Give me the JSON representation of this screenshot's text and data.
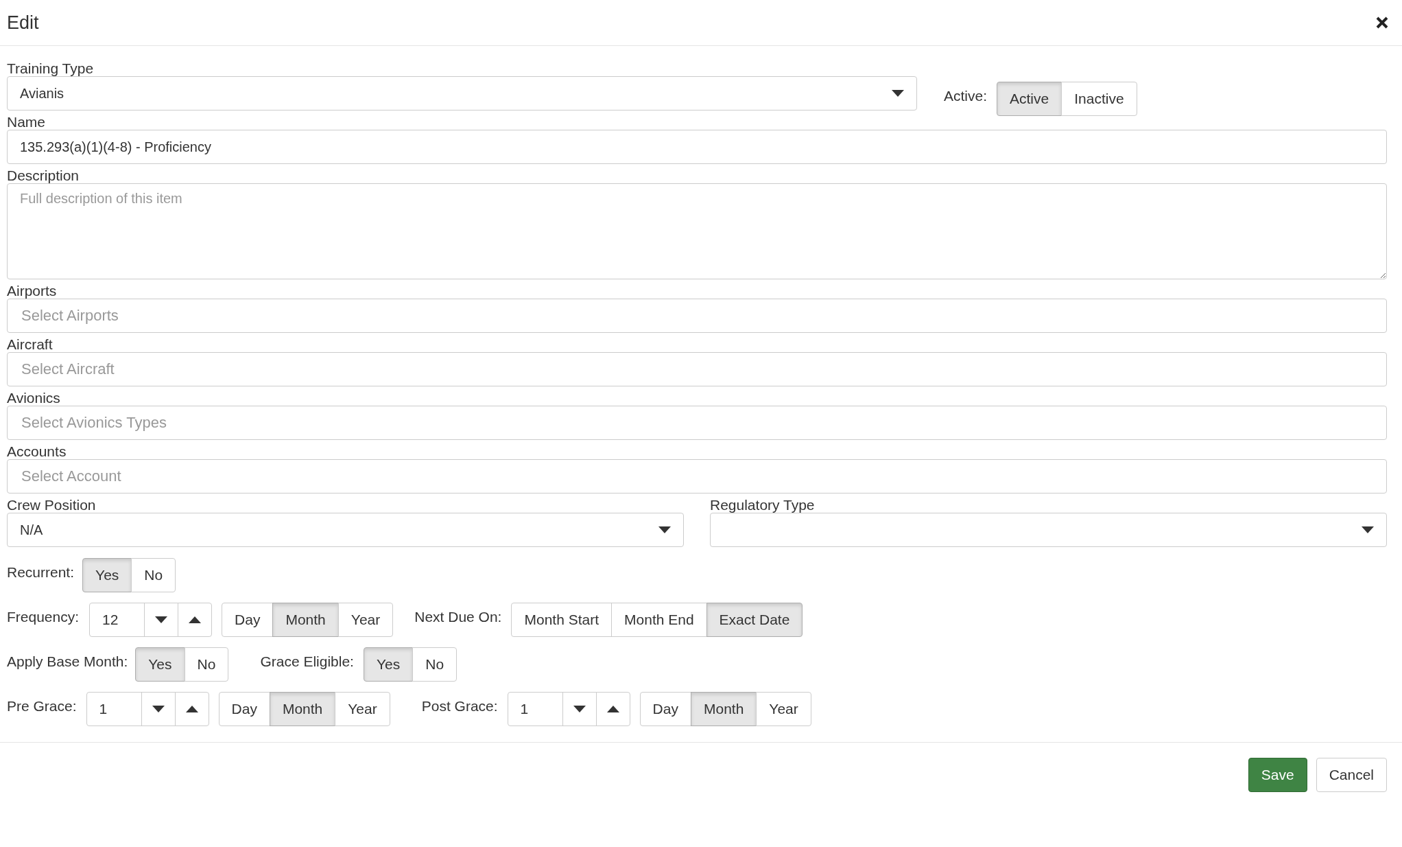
{
  "dialog": {
    "title": "Edit"
  },
  "training_type": {
    "label": "Training Type",
    "value": "Avianis"
  },
  "active": {
    "label": "Active:",
    "options": [
      {
        "label": "Active",
        "selected": true
      },
      {
        "label": "Inactive",
        "selected": false
      }
    ]
  },
  "name": {
    "label": "Name",
    "value": "135.293(a)(1)(4-8) - Proficiency"
  },
  "description": {
    "label": "Description",
    "placeholder": "Full description of this item"
  },
  "multi_selects": [
    {
      "label": "Airports",
      "placeholder": "Select Airports"
    },
    {
      "label": "Aircraft",
      "placeholder": "Select Aircraft"
    },
    {
      "label": "Avionics",
      "placeholder": "Select Avionics Types"
    },
    {
      "label": "Accounts",
      "placeholder": "Select Account"
    }
  ],
  "crew_position": {
    "label": "Crew Position",
    "value": "N/A"
  },
  "regulatory_type": {
    "label": "Regulatory Type"
  },
  "recurrent": {
    "label": "Recurrent:",
    "options": [
      {
        "label": "Yes",
        "selected": true
      },
      {
        "label": "No",
        "selected": false
      }
    ]
  },
  "frequency": {
    "label": "Frequency:",
    "value": "12",
    "units": [
      {
        "label": "Day",
        "selected": false
      },
      {
        "label": "Month",
        "selected": true
      },
      {
        "label": "Year",
        "selected": false
      }
    ]
  },
  "next_due_on": {
    "label": "Next Due On:",
    "options": [
      {
        "label": "Month Start",
        "selected": false
      },
      {
        "label": "Month End",
        "selected": false
      },
      {
        "label": "Exact Date",
        "selected": true
      }
    ]
  },
  "apply_base_month": {
    "label": "Apply Base Month:",
    "options": [
      {
        "label": "Yes",
        "selected": true
      },
      {
        "label": "No",
        "selected": false
      }
    ]
  },
  "grace_eligible": {
    "label": "Grace Eligible:",
    "options": [
      {
        "label": "Yes",
        "selected": true
      },
      {
        "label": "No",
        "selected": false
      }
    ]
  },
  "pre_grace": {
    "label": "Pre Grace:",
    "value": "1",
    "units": [
      {
        "label": "Day",
        "selected": false
      },
      {
        "label": "Month",
        "selected": true
      },
      {
        "label": "Year",
        "selected": false
      }
    ]
  },
  "post_grace": {
    "label": "Post Grace:",
    "value": "1",
    "units": [
      {
        "label": "Day",
        "selected": false
      },
      {
        "label": "Month",
        "selected": true
      },
      {
        "label": "Year",
        "selected": false
      }
    ]
  },
  "buttons": [
    {
      "label": "Save",
      "kind": "primary"
    },
    {
      "label": "Cancel",
      "kind": "secondary"
    }
  ]
}
